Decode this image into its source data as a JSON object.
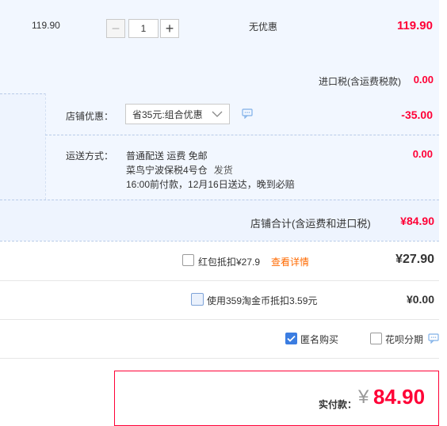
{
  "item": {
    "unit_price": "119.90",
    "quantity": "1",
    "minus_symbol": "−",
    "plus_symbol": "+",
    "promotion": "无优惠",
    "total": "119.90",
    "tax_label": "进口税(含运费税款)",
    "tax_value": "0.00"
  },
  "shop": {
    "discount_label": "店铺优惠：",
    "discount_selected": "省35元:组合优惠",
    "discount_value": "-35.00",
    "delivery_label": "运送方式：",
    "delivery_line1": "普通配送 运费 免邮",
    "delivery_warehouse": "菜鸟宁波保税4号仓",
    "delivery_ship": "发货",
    "delivery_line3": "16:00前付款，12月16日送达，晚到必赔",
    "delivery_value": "0.00",
    "total_label": "店铺合计(含运费和进口税)",
    "total_value": "¥84.90"
  },
  "deductions": {
    "redpacket_label": "红包抵扣¥27.9",
    "redpacket_link": "查看详情",
    "redpacket_value": "¥27.90",
    "coin_label": "使用359淘金币抵扣3.59元",
    "coin_value": "¥0.00"
  },
  "options": {
    "anonymous_label": "匿名购买",
    "huabei_label": "花呗分期"
  },
  "payment": {
    "label": "实付款：",
    "currency": "¥",
    "amount": "84.90"
  },
  "colors": {
    "price_red": "#ff0036",
    "link_orange": "#ff6a00",
    "panel_blue": "#f2f7ff",
    "checkbox_checked": "#3b7de1"
  },
  "icons": [
    "minus-icon",
    "plus-icon",
    "chevron-down-icon",
    "comment-icon",
    "checkmark-icon"
  ]
}
